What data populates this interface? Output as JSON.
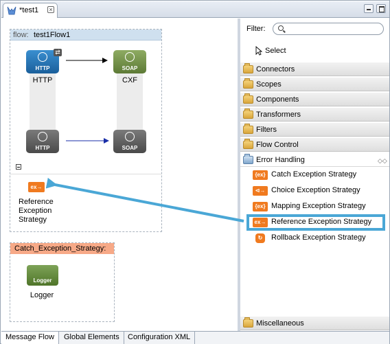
{
  "editor_tab": {
    "title": "*test1"
  },
  "flow": {
    "label_key": "flow:",
    "label_value": "test1Flow1",
    "nodes": {
      "http_in": {
        "icon_text": "HTTP",
        "label": "HTTP"
      },
      "cxf_in": {
        "icon_text": "SOAP",
        "label": "CXF"
      },
      "http_out": {
        "icon_text": "HTTP"
      },
      "cxf_out": {
        "icon_text": "SOAP"
      }
    },
    "exception": {
      "icon_text": "ex→",
      "label_lines": [
        "Reference",
        "Exception",
        "Strategy"
      ]
    }
  },
  "catch_strategy": {
    "title": "Catch_Exception_Strategy:",
    "logger": {
      "icon_text": "Logger",
      "label": "Logger"
    }
  },
  "palette": {
    "filter_label": "Filter:",
    "filter_value": "",
    "select_label": "Select",
    "categories": [
      {
        "label": "Connectors"
      },
      {
        "label": "Scopes"
      },
      {
        "label": "Components"
      },
      {
        "label": "Transformers"
      },
      {
        "label": "Filters"
      },
      {
        "label": "Flow Control"
      },
      {
        "label": "Error Handling"
      }
    ],
    "error_items": [
      {
        "icon": "{ex}",
        "label": "Catch Exception Strategy"
      },
      {
        "icon": "⊲→",
        "label": "Choice Exception Strategy"
      },
      {
        "icon": "{ex}",
        "label": "Mapping Exception Strategy"
      },
      {
        "icon": "ex→",
        "label": "Reference Exception Strategy"
      },
      {
        "icon": "↻",
        "label": "Rollback Exception Strategy"
      }
    ],
    "misc_label": "Miscellaneous"
  },
  "bottom_tabs": [
    "Message Flow",
    "Global Elements",
    "Configuration XML"
  ],
  "colors": {
    "accent_arrow": "#4aa7d6",
    "exception_orange": "#f07a1f",
    "catch_header": "#f7a987"
  }
}
